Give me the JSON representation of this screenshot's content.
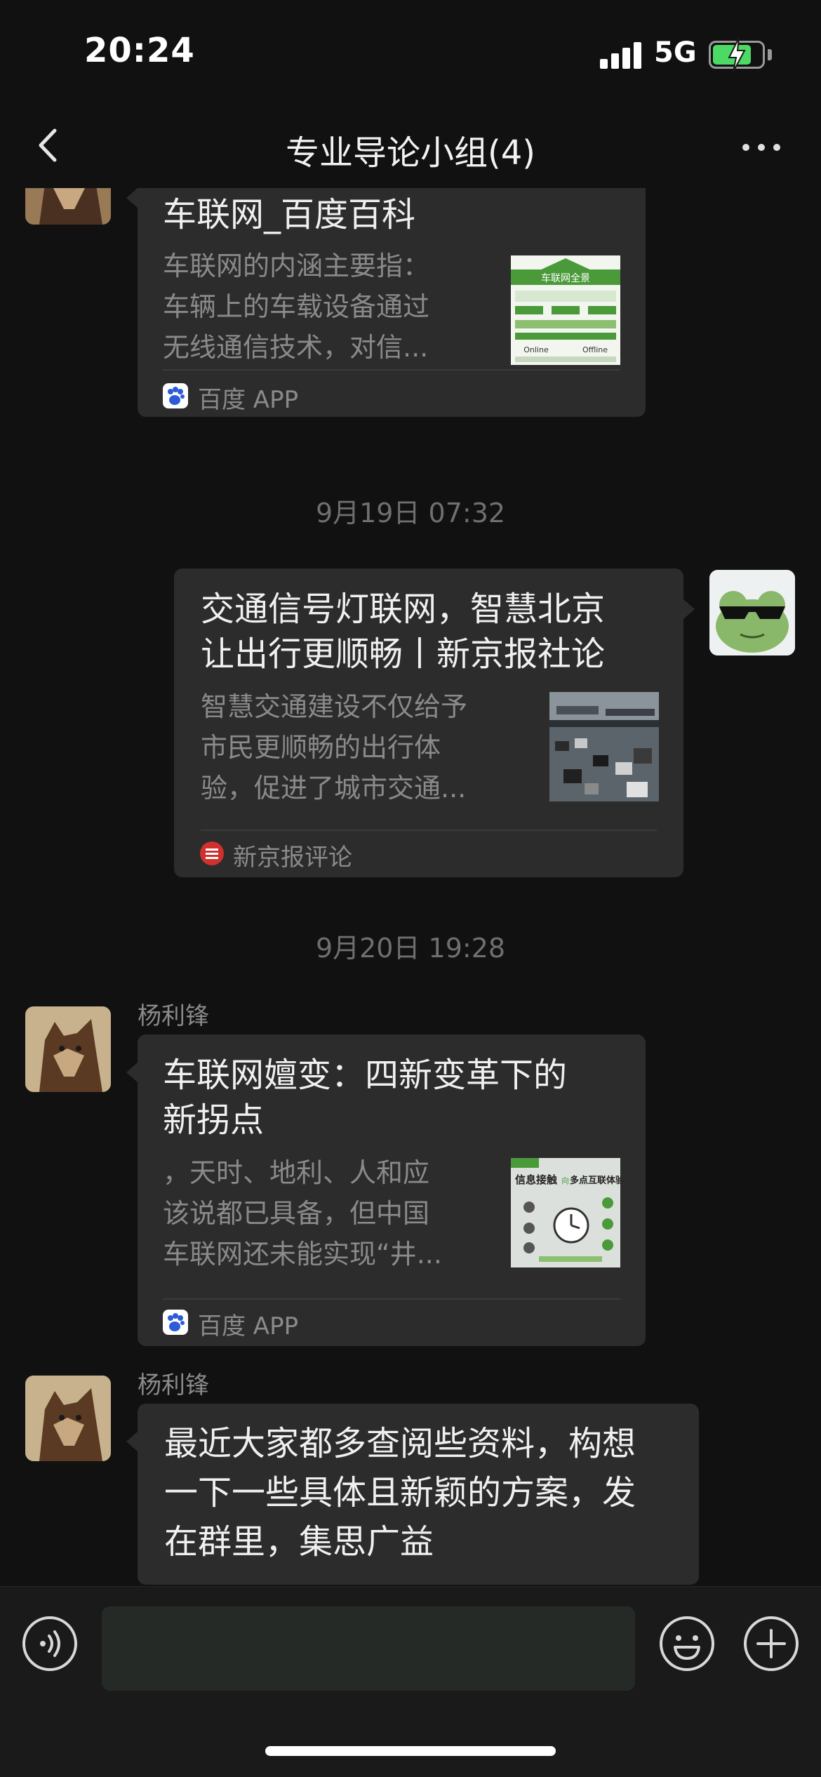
{
  "status_bar": {
    "time": "20:24",
    "network": "5G",
    "battery_level": 0.8
  },
  "nav": {
    "title": "专业导论小组(4)"
  },
  "messages": [
    {
      "type": "link_card",
      "title": "车联网_百度百科",
      "desc": "车联网的内涵主要指：车辆上的车载设备通过无线通信技术，对信...",
      "desc_lines": [
        "车联网的内涵主要指：",
        "车辆上的车载设备通过",
        "无线通信技术，对信..."
      ],
      "thumb_text": {
        "heading": "车联网全景",
        "left": "Online",
        "right": "Offline"
      },
      "source": "百度 APP"
    },
    {
      "type": "timestamp",
      "text": "9月19日 07:32"
    },
    {
      "type": "link_card",
      "title_lines": [
        "交通信号灯联网，智慧北京",
        "让出行更顺畅丨新京报社论"
      ],
      "desc_lines": [
        "智慧交通建设不仅给予",
        "市民更顺畅的出行体",
        "验，促进了城市交通..."
      ],
      "source": "新京报评论"
    },
    {
      "type": "timestamp",
      "text": "9月20日 19:28"
    },
    {
      "type": "link_card",
      "sender": "杨利锋",
      "title_lines": [
        "车联网嬗变：四新变革下的",
        "新拐点"
      ],
      "desc_lines": [
        "，天时、地利、人和应",
        "该说都已具备，但中国",
        "车联网还未能实现“井..."
      ],
      "thumb_text": {
        "left": "信息接触",
        "mid": "向",
        "right": "多点互联体验"
      },
      "source": "百度 APP"
    },
    {
      "type": "text",
      "sender": "杨利锋",
      "lines": [
        "最近大家都多查阅些资料，构想",
        "一下一些具体且新颖的方案，发",
        "在群里，集思广益"
      ]
    }
  ],
  "colors": {
    "background": "#111111",
    "bubble": "#2c2c2c",
    "accent_green": "#4cd964",
    "muted_text": "#8a8a8a"
  },
  "icons": [
    "back-chevron-icon",
    "more-dots-icon",
    "voice-icon",
    "emoji-icon",
    "plus-icon",
    "baidu-paw-icon",
    "xinjingbao-icon"
  ]
}
